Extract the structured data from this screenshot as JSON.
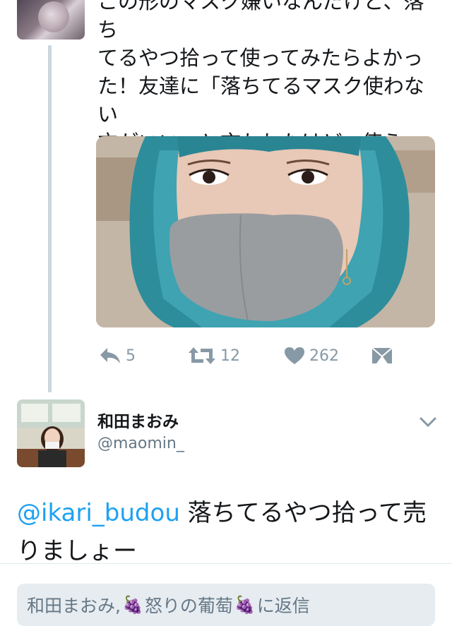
{
  "tweet1": {
    "text": "この形のマスク嫌いなんだけど、落ち\nてるやつ拾って使ってみたらよかっ\nた！友達に「落ちてるマスク使わない\n方がいい」と言われたけど、使うよ。\n無料だもん。",
    "actions": {
      "reply_count": "5",
      "retweet_count": "12",
      "like_count": "262"
    },
    "icons": [
      "reply-icon",
      "retweet-icon",
      "like-icon",
      "direct-message-icon"
    ]
  },
  "tweet2": {
    "display_name": "和田まおみ",
    "handle": "@maomin_",
    "mention": "@ikari_budou",
    "text": " 落ちてるやつ拾って売りましょー"
  },
  "composer": {
    "prefix": "和田まおみ, ",
    "grape1": "🍇",
    "middle": " 怒りの葡萄",
    "grape2": "🍇",
    "suffix": " に返信"
  },
  "colors": {
    "accent": "#1da1f2",
    "icon_gray": "#8899a6",
    "thread_line": "#ccd6dd",
    "composer_bg": "#e6ecf0"
  }
}
